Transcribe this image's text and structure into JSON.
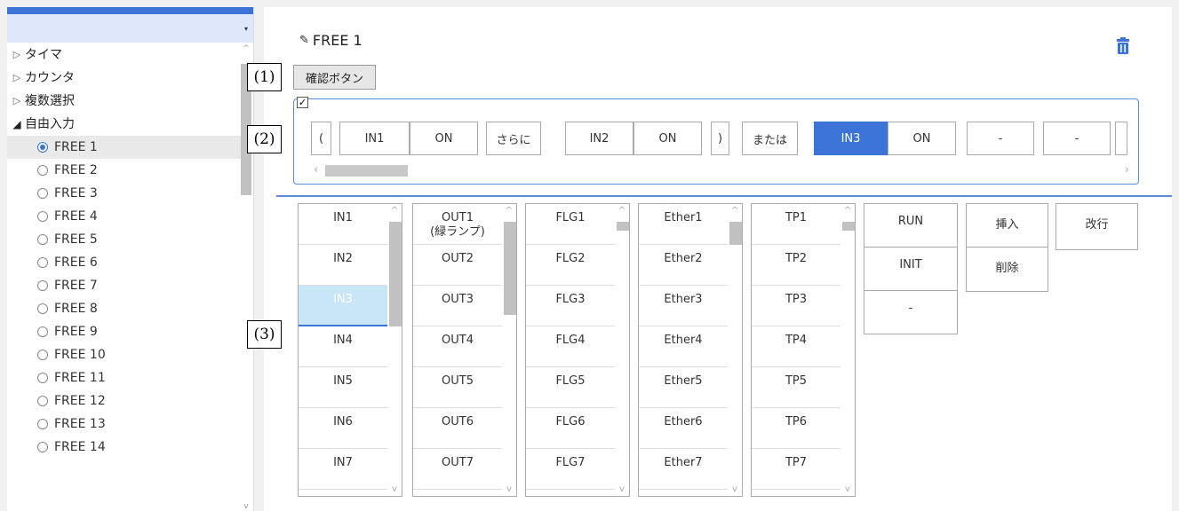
{
  "sidebar": {
    "groups": [
      {
        "label": "タイマ",
        "expanded": false
      },
      {
        "label": "カウンタ",
        "expanded": false
      },
      {
        "label": "複数選択",
        "expanded": false
      },
      {
        "label": "自由入力",
        "expanded": true
      }
    ],
    "free_items": [
      "FREE 1",
      "FREE 2",
      "FREE 3",
      "FREE 4",
      "FREE 5",
      "FREE 6",
      "FREE 7",
      "FREE 8",
      "FREE 9",
      "FREE 10",
      "FREE 11",
      "FREE 12",
      "FREE 13",
      "FREE 14"
    ],
    "selected_item": "FREE 1"
  },
  "main": {
    "title": "FREE 1",
    "trash_icon": "trash-icon",
    "markers": [
      "(1)",
      "(2)",
      "(3)"
    ],
    "confirm_button": "確認ボタン",
    "condition_tokens": [
      "(",
      "IN1",
      "ON",
      "さらに",
      "IN2",
      "ON",
      ")",
      "または",
      "IN3",
      "ON",
      "-",
      "-"
    ],
    "selected_token": "IN3",
    "lists": {
      "in": [
        "IN1",
        "IN2",
        "IN3",
        "IN4",
        "IN5",
        "IN6",
        "IN7"
      ],
      "out": [
        "OUT1\n(緑ランプ)",
        "OUT2",
        "OUT3",
        "OUT4",
        "OUT5",
        "OUT6",
        "OUT7"
      ],
      "flg": [
        "FLG1",
        "FLG2",
        "FLG3",
        "FLG4",
        "FLG5",
        "FLG6",
        "FLG7"
      ],
      "ether": [
        "Ether1",
        "Ether2",
        "Ether3",
        "Ether4",
        "Ether5",
        "Ether6",
        "Ether7"
      ],
      "tp": [
        "TP1",
        "TP2",
        "TP3",
        "TP4",
        "TP5",
        "TP6",
        "TP7"
      ]
    },
    "selected_list_item": "IN3",
    "op_buttons": [
      "RUN",
      "INIT",
      "-"
    ],
    "edit_buttons": [
      "挿入",
      "削除"
    ],
    "newline_button": "改行"
  },
  "colors": {
    "accent": "#3b73d6",
    "selected_cell": "#c9e5f8"
  }
}
